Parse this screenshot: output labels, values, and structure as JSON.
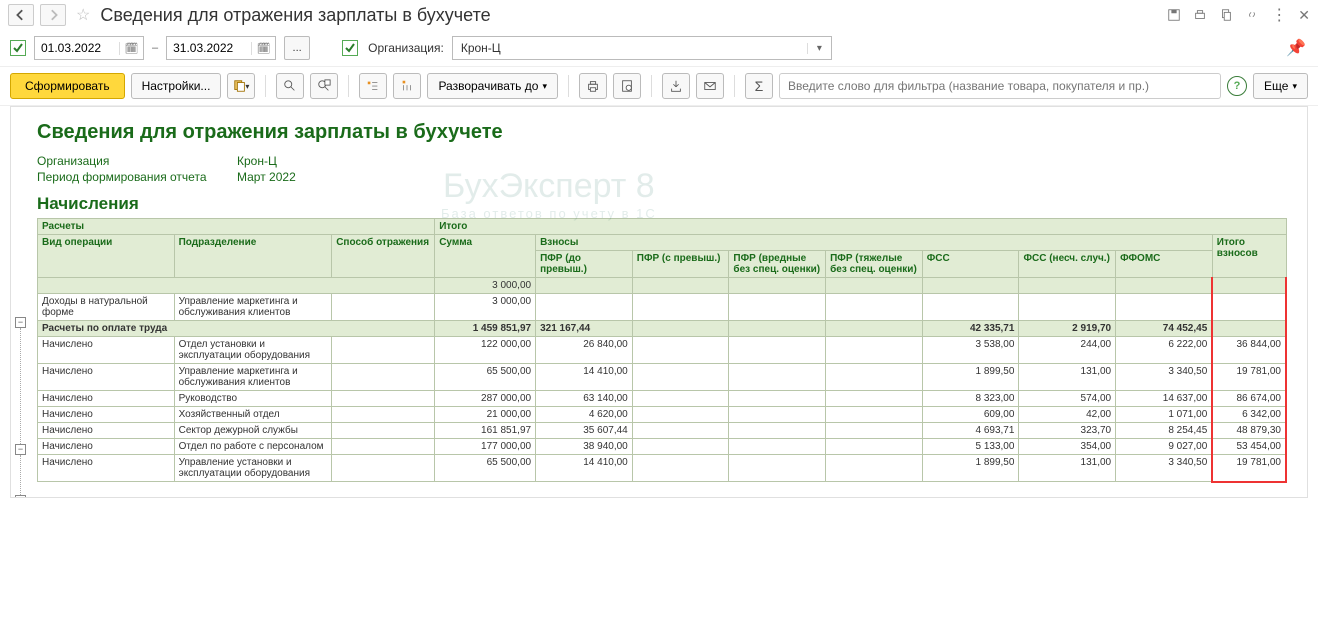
{
  "title": "Сведения для отражения зарплаты в бухучете",
  "dates": {
    "from": "01.03.2022",
    "to": "31.03.2022"
  },
  "org_label": "Организация:",
  "org_value": "Крон-Ц",
  "toolbar": {
    "form": "Сформировать",
    "settings": "Настройки...",
    "expand": "Разворачивать до",
    "filter_ph": "Введите слово для фильтра (название товара, покупателя и пр.)",
    "more": "Еще"
  },
  "report": {
    "title": "Сведения для отражения зарплаты в бухучете",
    "meta": {
      "org_lbl": "Организация",
      "org_val": "Крон-Ц",
      "period_lbl": "Период формирования отчета",
      "period_val": "Март 2022"
    },
    "section": "Начисления",
    "headers": {
      "top_calc": "Расчеты",
      "top_total": "Итого",
      "op": "Вид операции",
      "dep": "Подразделение",
      "spo": "Способ отражения",
      "sum": "Сумма",
      "vzn": "Взносы",
      "pfr_do": "ПФР (до превыш.)",
      "pfr_s": "ПФР (с превыш.)",
      "pfr_vr": "ПФР (вредные без спец. оценки)",
      "pfr_tj": "ПФР (тяжелые без спец. оценки)",
      "fss": "ФСС",
      "fss_n": "ФСС (несч. случ.)",
      "ffoms": "ФФОМС",
      "itog": "Итого взносов"
    },
    "top_total": {
      "sum": "3 000,00"
    },
    "rows_pre": [
      {
        "op": "Доходы в натуральной форме",
        "dep": "Управление маркетинга и обслуживания клиентов",
        "sum": "3 000,00"
      }
    ],
    "group": {
      "label": "Расчеты по оплате труда",
      "sum": "1 459 851,97",
      "pfr_do": "321 167,44",
      "fss": "42 335,71",
      "fss_n": "2 919,70",
      "ffoms": "74 452,45"
    },
    "rows": [
      {
        "op": "Начислено",
        "dep": "Отдел установки и эксплуатации оборудования",
        "sum": "122 000,00",
        "pfr_do": "26 840,00",
        "fss": "3 538,00",
        "fss_n": "244,00",
        "ffoms": "6 222,00",
        "itog": "36 844,00"
      },
      {
        "op": "Начислено",
        "dep": "Управление маркетинга и обслуживания клиентов",
        "sum": "65 500,00",
        "pfr_do": "14 410,00",
        "fss": "1 899,50",
        "fss_n": "131,00",
        "ffoms": "3 340,50",
        "itog": "19 781,00"
      },
      {
        "op": "Начислено",
        "dep": "Руководство",
        "sum": "287 000,00",
        "pfr_do": "63 140,00",
        "fss": "8 323,00",
        "fss_n": "574,00",
        "ffoms": "14 637,00",
        "itog": "86 674,00"
      },
      {
        "op": "Начислено",
        "dep": "Хозяйственный отдел",
        "sum": "21 000,00",
        "pfr_do": "4 620,00",
        "fss": "609,00",
        "fss_n": "42,00",
        "ffoms": "1 071,00",
        "itog": "6 342,00"
      },
      {
        "op": "Начислено",
        "dep": "Сектор дежурной службы",
        "sum": "161 851,97",
        "pfr_do": "35 607,44",
        "fss": "4 693,71",
        "fss_n": "323,70",
        "ffoms": "8 254,45",
        "itog": "48 879,30"
      },
      {
        "op": "Начислено",
        "dep": "Отдел по работе с персоналом",
        "sum": "177 000,00",
        "pfr_do": "38 940,00",
        "fss": "5 133,00",
        "fss_n": "354,00",
        "ffoms": "9 027,00",
        "itog": "53 454,00"
      },
      {
        "op": "Начислено",
        "dep": "Управление установки и эксплуатации оборудования",
        "sum": "65 500,00",
        "pfr_do": "14 410,00",
        "fss": "1 899,50",
        "fss_n": "131,00",
        "ffoms": "3 340,50",
        "itog": "19 781,00"
      }
    ]
  },
  "watermark": {
    "l1": "БухЭксперт 8",
    "l2": "База ответов по учету в 1С"
  }
}
